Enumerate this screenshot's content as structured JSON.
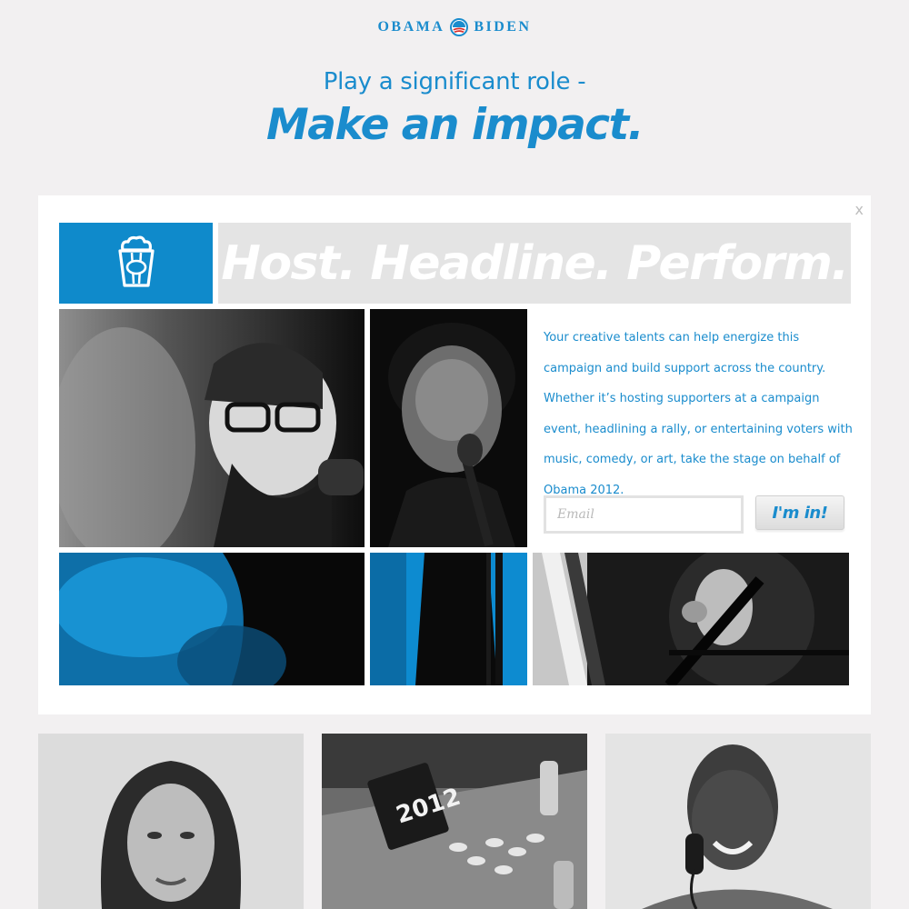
{
  "header": {
    "logo_left": "OBAMA",
    "logo_right": "BIDEN",
    "tagline": "Play a significant role -",
    "headline": "Make an impact."
  },
  "card": {
    "close_label": "x",
    "icon": "popcorn-icon",
    "banner": "Host. Headline. Perform.",
    "copy": "Your creative talents can help energize this campaign and build support across the country. Whether it’s hosting supporters at a campaign event, headlining a rally, or entertaining voters with music, comedy, or art, take the stage on behalf of Obama 2012.",
    "email_placeholder": "Email",
    "submit_label": "I'm in!"
  },
  "photos": {
    "grid": [
      "man-with-microphone-photo",
      "woman-singing-photo",
      "blue-blur-photo",
      "blue-microphone-stand-photo",
      "woman-singing-flag-photo"
    ],
    "bottom": [
      "woman-portrait-photo",
      "campaign-buttons-2012-photo",
      "man-on-phone-photo"
    ],
    "button_text": "2012"
  },
  "colors": {
    "brand_blue": "#1a8ccd",
    "background": "#f2f0f1",
    "banner_gray": "#e4e4e4"
  }
}
